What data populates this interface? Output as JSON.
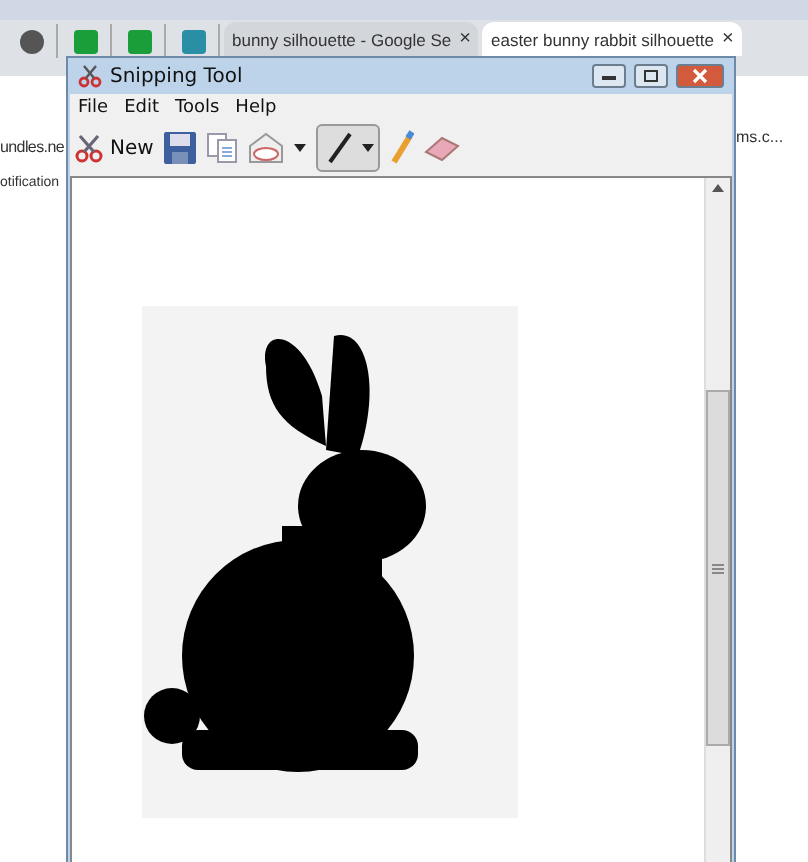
{
  "browser": {
    "tabs": [
      {
        "kind": "pinned",
        "color": "#555555"
      },
      {
        "kind": "pinned",
        "color": "#1a9e3a"
      },
      {
        "kind": "pinned",
        "color": "#1a9e3a"
      },
      {
        "kind": "pinned",
        "color": "#2a8fa5"
      },
      {
        "kind": "page",
        "title": "bunny silhouette - Google Se",
        "close": "×",
        "selected": false
      },
      {
        "kind": "page",
        "title": "easter bunny rabbit silhouette",
        "close": "×",
        "selected": true
      }
    ],
    "page_texts_left": [
      "undles.ne",
      "otification"
    ],
    "page_text_right": "ms.c..."
  },
  "window": {
    "title": "Snipping Tool",
    "menu": [
      "File",
      "Edit",
      "Tools",
      "Help"
    ],
    "toolbar": {
      "new_label": "New"
    }
  }
}
